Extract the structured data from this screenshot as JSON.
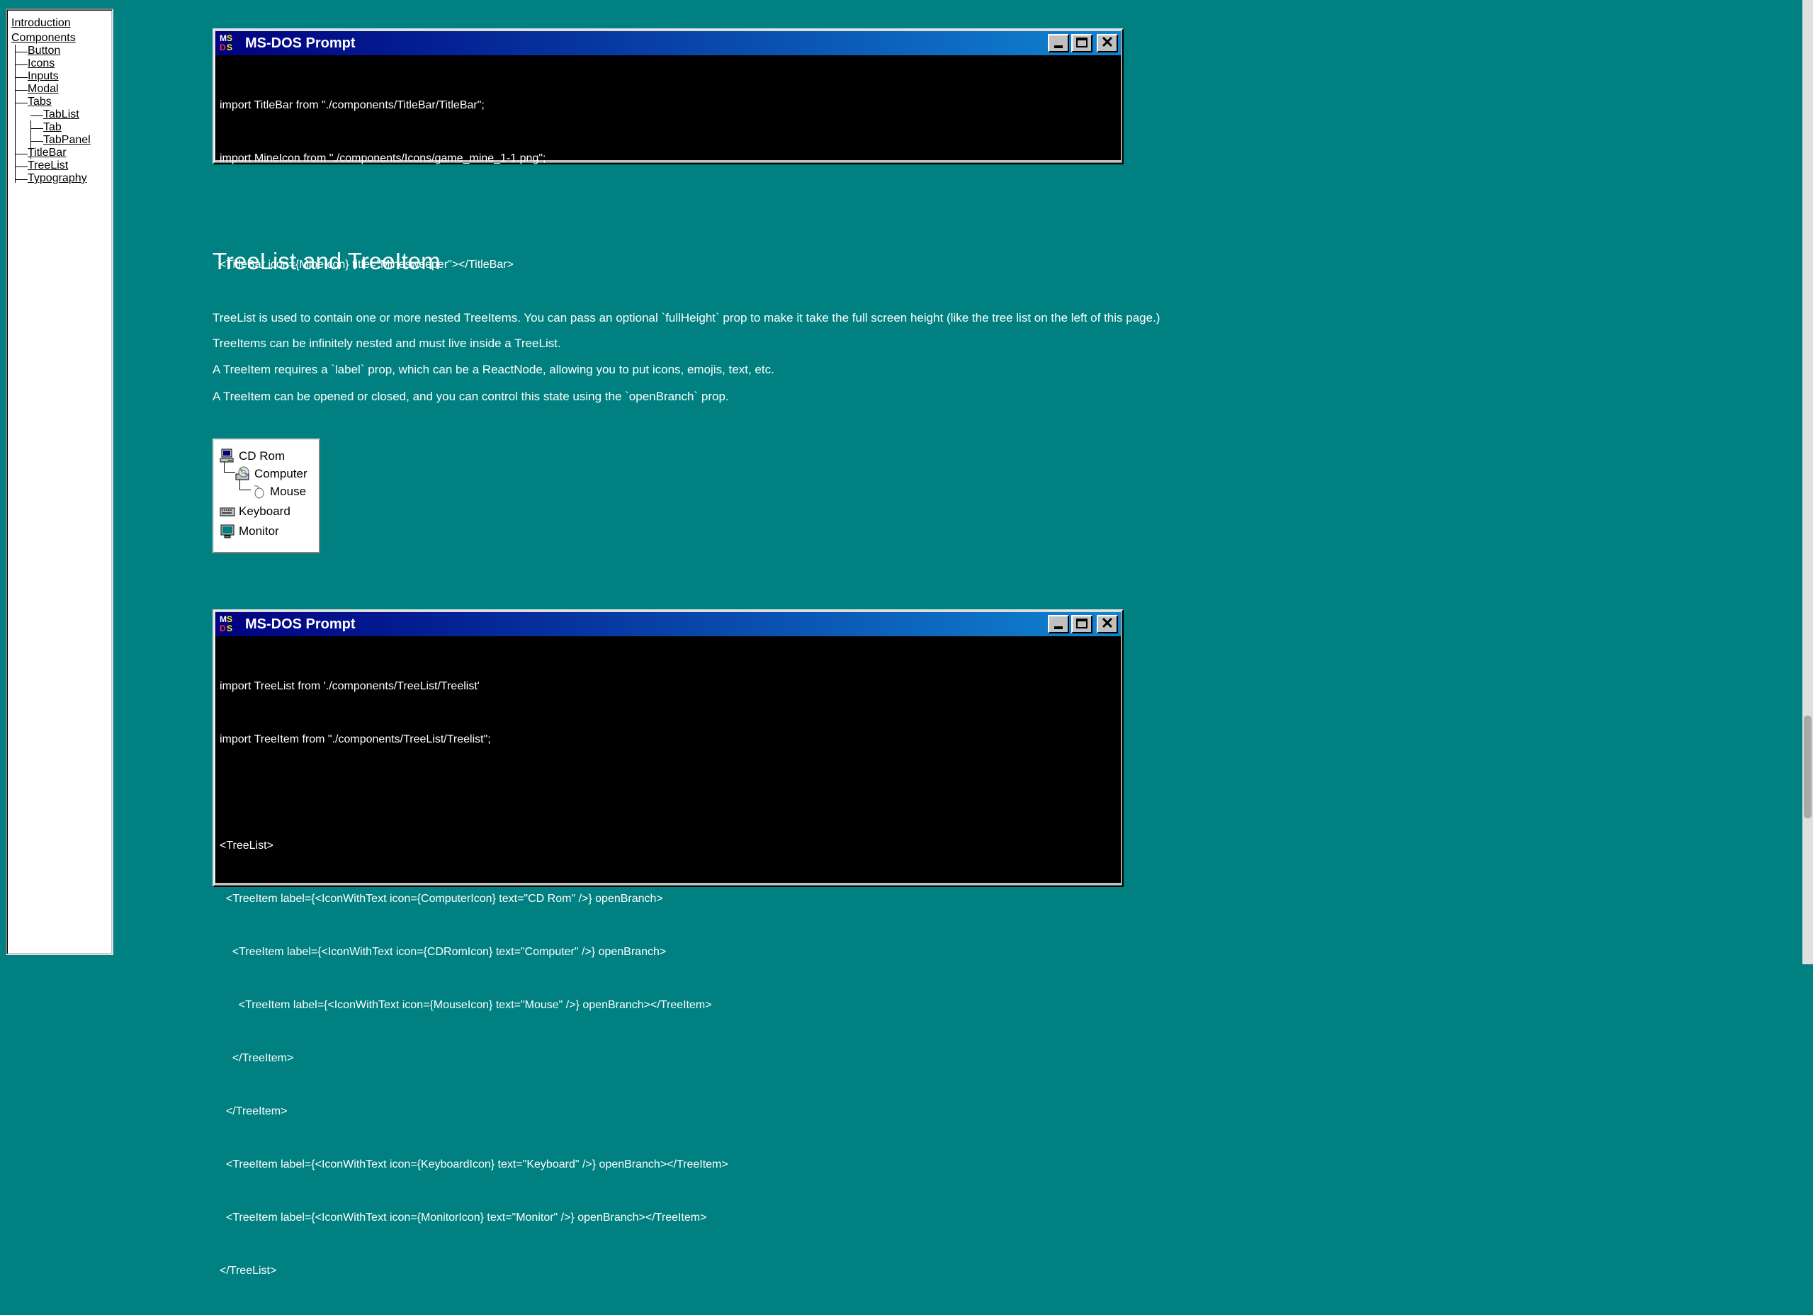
{
  "sidebar": {
    "top_items": [
      {
        "label": "Introduction"
      },
      {
        "label": "Components"
      }
    ],
    "components": [
      {
        "label": "Button"
      },
      {
        "label": "Icons"
      },
      {
        "label": "Inputs"
      },
      {
        "label": "Modal"
      },
      {
        "label": "Tabs"
      },
      {
        "label": "TitleBar"
      },
      {
        "label": "TreeList"
      },
      {
        "label": "Typography"
      }
    ],
    "tabs_children": [
      {
        "label": "TabList"
      },
      {
        "label": "Tab"
      },
      {
        "label": "TabPanel"
      }
    ]
  },
  "window1": {
    "title": "MS-DOS Prompt",
    "icon": "ms-dos-icon",
    "buttons": {
      "minimize": "minimize-icon",
      "maximize": "maximize-icon",
      "close": "close-icon"
    },
    "code_lines": [
      "import TitleBar from \"./components/TitleBar/TitleBar\";",
      "import MineIcon from \"./components/Icons/game_mine_1-1.png\";",
      "",
      "<TitleBar icon={MineIcon} title=\"Minesweeper\"></TitleBar>"
    ]
  },
  "section": {
    "heading": "TreeList and TreeItem",
    "paragraphs": [
      "TreeList is used to contain one or more nested TreeItems. You can pass an optional `fullHeight` prop to make it take the full screen height (like the tree list on the left of this page.)",
      "TreeItems can be infinitely nested and must live inside a TreeList.",
      "A TreeItem requires a `label` prop, which can be a ReactNode, allowing you to put icons, emojis, text, etc.",
      "A TreeItem can be opened or closed, and you can control this state using the `openBranch` prop."
    ]
  },
  "demo_tree": {
    "items": [
      {
        "label": "CD Rom",
        "icon": "computer-icon"
      },
      {
        "label": "Computer",
        "icon": "cd-rom-icon"
      },
      {
        "label": "Mouse",
        "icon": "mouse-icon"
      },
      {
        "label": "Keyboard",
        "icon": "keyboard-icon"
      },
      {
        "label": "Monitor",
        "icon": "monitor-icon"
      }
    ]
  },
  "window2": {
    "title": "MS-DOS Prompt",
    "icon": "ms-dos-icon",
    "buttons": {
      "minimize": "minimize-icon",
      "maximize": "maximize-icon",
      "close": "close-icon"
    },
    "code_lines": [
      "import TreeList from './components/TreeList/Treelist'",
      "import TreeItem from \"./components/TreeList/Treelist\";",
      "",
      "<TreeList>",
      "  <TreeItem label={<IconWithText icon={ComputerIcon} text=\"CD Rom\" />} openBranch>",
      "    <TreeItem label={<IconWithText icon={CDRomIcon} text=\"Computer\" />} openBranch>",
      "      <TreeItem label={<IconWithText icon={MouseIcon} text=\"Mouse\" />} openBranch></TreeItem>",
      "    </TreeItem>",
      "  </TreeItem>",
      "  <TreeItem label={<IconWithText icon={KeyboardIcon} text=\"Keyboard\" />} openBranch></TreeItem>",
      "  <TreeItem label={<IconWithText icon={MonitorIcon} text=\"Monitor\" />} openBranch></TreeItem>",
      "</TreeList>"
    ]
  },
  "colors": {
    "desktop": "#008080",
    "titlebar_start": "#000080",
    "titlebar_end": "#1084d0",
    "console_bg": "#000000",
    "console_text": "#ffffff"
  }
}
